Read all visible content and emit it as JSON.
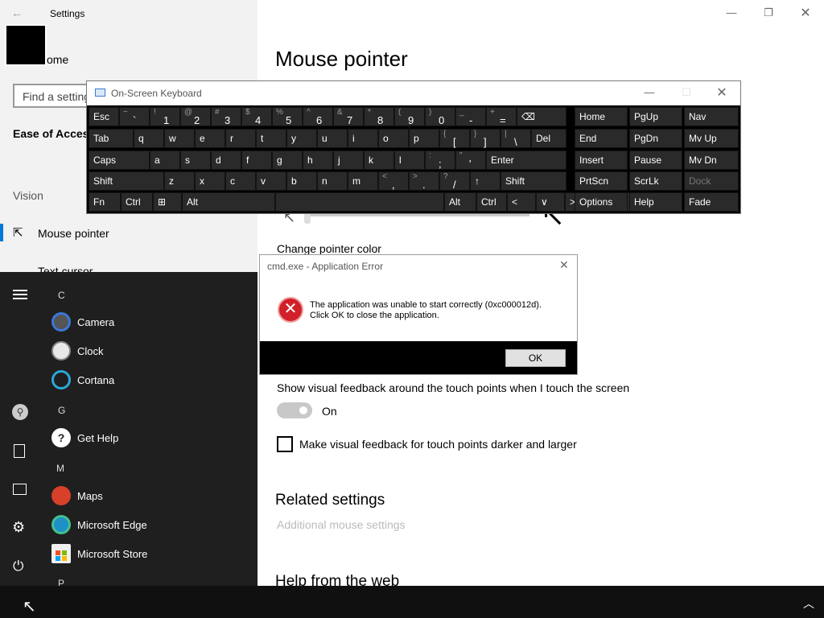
{
  "settings": {
    "title": "Settings",
    "home_label": "Home",
    "home_partial": "ome",
    "search_placeholder": "Find a setting",
    "category": "Ease of Access",
    "group": "Vision",
    "nav_items": [
      "Mouse pointer",
      "Text cursor"
    ],
    "page_title": "Mouse pointer",
    "change_pointer_color": "Change pointer color",
    "touch_feedback_label": "Show visual feedback around the touch points when I touch the screen",
    "toggle_state": "On",
    "toggle_on": true,
    "darker_checkbox_label": "Make visual feedback for touch points darker and larger",
    "darker_checked": false,
    "related_heading": "Related settings",
    "additional_mouse_link": "Additional mouse settings",
    "help_heading": "Help from the web"
  },
  "osk": {
    "title": "On-Screen Keyboard",
    "row1": [
      {
        "main": "Esc"
      },
      {
        "sup": "~",
        "low": "`"
      },
      {
        "sup": "!",
        "low": "1"
      },
      {
        "sup": "@",
        "low": "2"
      },
      {
        "sup": "#",
        "low": "3"
      },
      {
        "sup": "$",
        "low": "4"
      },
      {
        "sup": "%",
        "low": "5"
      },
      {
        "sup": "^",
        "low": "6"
      },
      {
        "sup": "&",
        "low": "7"
      },
      {
        "sup": "*",
        "low": "8"
      },
      {
        "sup": "(",
        "low": "9"
      },
      {
        "sup": ")",
        "low": "0"
      },
      {
        "sup": "_",
        "low": "-"
      },
      {
        "sup": "+",
        "low": "="
      },
      {
        "main": "⌫"
      }
    ],
    "row2": [
      "Tab",
      "q",
      "w",
      "e",
      "r",
      "t",
      "y",
      "u",
      "i",
      "o",
      "p",
      "[",
      "]",
      "\\",
      "Del"
    ],
    "row2_sup": {
      "[": "{",
      "]": "}",
      "\\": "|"
    },
    "row3": [
      "Caps",
      "a",
      "s",
      "d",
      "f",
      "g",
      "h",
      "j",
      "k",
      "l",
      ";",
      "'",
      "Enter"
    ],
    "row3_sup": {
      ";": ":",
      "'": "\""
    },
    "row4": [
      "Shift",
      "z",
      "x",
      "c",
      "v",
      "b",
      "n",
      "m",
      ",",
      ".",
      "/",
      "↑",
      "Shift"
    ],
    "row4_sup": {
      ",": "<",
      ".": ">",
      "/": "?"
    },
    "row5": [
      "Fn",
      "Ctrl",
      "⊞",
      "Alt",
      "",
      "Alt",
      "Ctrl",
      "<",
      "∨",
      ">",
      "▤"
    ],
    "right_keys": [
      [
        "Home",
        "PgUp",
        "Nav"
      ],
      [
        "End",
        "PgDn",
        "Mv Up"
      ],
      [
        "Insert",
        "Pause",
        "Mv Dn"
      ],
      [
        "PrtScn",
        "ScrLk",
        "Dock"
      ],
      [
        "Options",
        "Help",
        "Fade"
      ]
    ]
  },
  "dialog": {
    "title": "cmd.exe - Application Error",
    "message_line1": "The application was unable to start correctly (0xc000012d).",
    "message_line2": "Click OK to close the application.",
    "ok_label": "OK"
  },
  "start_menu": {
    "letters": [
      "C",
      "G",
      "M",
      "P"
    ],
    "apps": [
      {
        "label": "Camera",
        "icon": "camera-icon",
        "color": "#3a78d8"
      },
      {
        "label": "Clock",
        "icon": "clock-icon",
        "color": "#c8c8c8"
      },
      {
        "label": "Cortana",
        "icon": "cortana-icon",
        "color": "#2aa8d8"
      },
      {
        "label": "Get Help",
        "icon": "help-icon",
        "color": "#ffffff"
      },
      {
        "label": "Maps",
        "icon": "maps-icon",
        "color": "#d8402a"
      },
      {
        "label": "Microsoft Edge",
        "icon": "edge-icon",
        "color": "#1e90c8"
      },
      {
        "label": "Microsoft Store",
        "icon": "store-icon",
        "color": "#f0f0f0"
      }
    ]
  },
  "colors": {
    "accent": "#0078d7",
    "error": "#d0202a"
  }
}
